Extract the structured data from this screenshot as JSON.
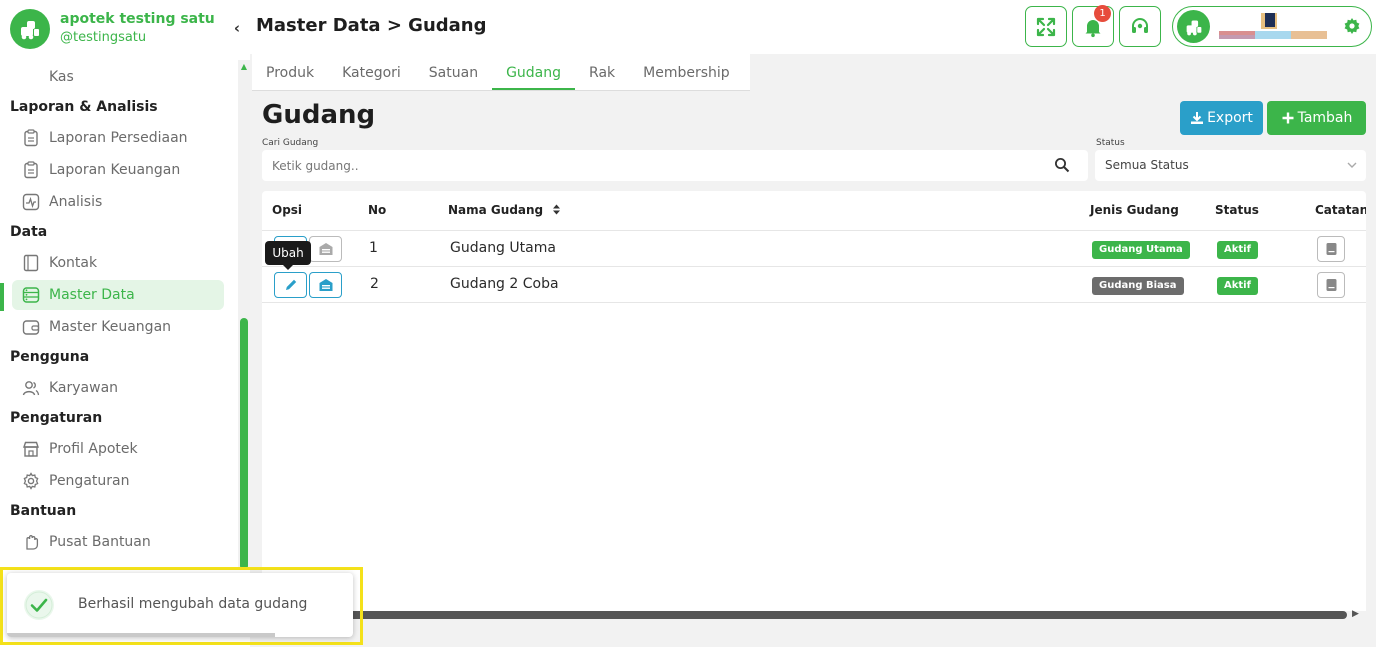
{
  "brand": {
    "name": "apotek testing satu",
    "handle": "@testingsatu"
  },
  "sidebar": {
    "top_item": "Kas",
    "sections": [
      {
        "title": "Laporan & Analisis",
        "items": [
          "Laporan Persediaan",
          "Laporan Keuangan",
          "Analisis"
        ]
      },
      {
        "title": "Data",
        "items": [
          "Kontak",
          "Master Data",
          "Master Keuangan"
        ]
      },
      {
        "title": "Pengguna",
        "items": [
          "Karyawan"
        ]
      },
      {
        "title": "Pengaturan",
        "items": [
          "Profil Apotek",
          "Pengaturan"
        ]
      },
      {
        "title": "Bantuan",
        "items": [
          "Pusat Bantuan"
        ]
      }
    ],
    "active_item": "Master Data"
  },
  "header": {
    "title": "Master Data > Gudang",
    "notification_count": "1",
    "icons": [
      "fullscreen-icon",
      "bell-icon",
      "headset-icon",
      "gear-icon"
    ]
  },
  "tabs": [
    {
      "label": "Produk",
      "active": false
    },
    {
      "label": "Kategori",
      "active": false
    },
    {
      "label": "Satuan",
      "active": false
    },
    {
      "label": "Gudang",
      "active": true
    },
    {
      "label": "Rak",
      "active": false
    },
    {
      "label": "Membership",
      "active": false
    }
  ],
  "content": {
    "title": "Gudang",
    "export_label": "Export",
    "add_label": "Tambah",
    "search_label": "Cari Gudang",
    "search_placeholder": "Ketik gudang..",
    "status_label": "Status",
    "status_value": "Semua Status"
  },
  "table": {
    "headers": {
      "opsi": "Opsi",
      "no": "No",
      "nama": "Nama Gudang",
      "jenis": "Jenis Gudang",
      "status": "Status",
      "catatan": "Catatan"
    },
    "rows": [
      {
        "no": "1",
        "nama": "Gudang Utama",
        "jenis": "Gudang Utama",
        "status": "Aktif"
      },
      {
        "no": "2",
        "nama": "Gudang 2 Coba",
        "jenis": "Gudang Biasa",
        "status": "Aktif"
      }
    ]
  },
  "tooltip": "Ubah",
  "toast": {
    "message": "Berhasil mengubah data gudang"
  },
  "colors": {
    "primary": "#3cb54a",
    "info": "#2a9fc9",
    "danger": "#e74c3c",
    "highlight": "#f4e11a"
  }
}
